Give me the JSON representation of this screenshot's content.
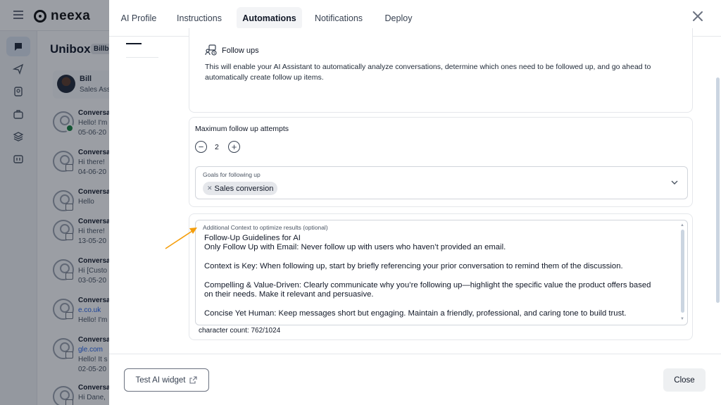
{
  "app": {
    "logo_text": "neexa",
    "unibox_title": "Unibox",
    "unibox_badge": "Billb",
    "pinned_contact": {
      "name": "Bill",
      "subtitle": "Sales Ass"
    },
    "conversations": [
      {
        "title": "Conversa",
        "line2": "Hello! I'm",
        "line3": "05-06-20",
        "channel": "whatsapp",
        "link": false
      },
      {
        "title": "Conversa",
        "line2": "Hi there! ",
        "line3": "04-06-20",
        "channel": "chat",
        "link": false
      },
      {
        "title": "Conversa",
        "line2": "Hello",
        "line3": "",
        "channel": "chat",
        "link": false
      },
      {
        "title": "Conversa",
        "line2": "Hi there! ",
        "line3": "13-05-20",
        "channel": "chat",
        "link": false
      },
      {
        "title": "Conversa",
        "line2": "Hi [Custo",
        "line3": "03-05-20",
        "channel": "chat",
        "link": false
      },
      {
        "title": "Conversa",
        "line2": "e.co.uk",
        "line3": "Hello! I'm",
        "channel": "email",
        "link": true
      },
      {
        "title": "Conversa",
        "line2": "gle.com",
        "line3": "Hello! It s",
        "line4": "02-05-20",
        "channel": "email",
        "link": true
      },
      {
        "title": "Conversa",
        "line2": "Hi Dane, ",
        "line3": "",
        "channel": "email",
        "link": false
      }
    ]
  },
  "modal": {
    "tabs": [
      {
        "label": "AI Profile",
        "active": false
      },
      {
        "label": "Instructions",
        "active": false
      },
      {
        "label": "Automations",
        "active": true
      },
      {
        "label": "Notifications",
        "active": false
      },
      {
        "label": "Deploy",
        "active": false
      }
    ],
    "close_icon": "close-icon",
    "follow_ups": {
      "icon": "follow-ups-icon",
      "title": "Follow ups",
      "description": "This will enable your AI Assistant to automatically analyze conversations, determine which ones need to be followed up, and go ahead to automatically create follow up items."
    },
    "max_attempts": {
      "label": "Maximum follow up attempts",
      "value": "2",
      "decrement_icon": "minus-circle-icon",
      "increment_icon": "plus-circle-icon"
    },
    "goals": {
      "label": "Goals for following up",
      "selected": [
        "Sales conversion"
      ]
    },
    "additional_context": {
      "label": "Additional Context to optimize results (optional)",
      "lines": [
        "Follow-Up Guidelines for AI",
        "Only Follow Up with Email: Never follow up with users who haven’t provided an email.",
        "",
        "Context is Key: When following up, start by briefly referencing your prior conversation to remind them of the discussion.",
        "",
        "Compelling & Value-Driven: Clearly communicate why you’re following up—highlight the specific value the product offers based",
        "on their needs. Make it relevant and persuasive.",
        "",
        "Concise Yet Human: Keep messages short but engaging. Maintain a friendly, professional, and caring tone to build trust."
      ],
      "char_count": "character count: 762/1024"
    },
    "footer": {
      "test_button": "Test AI widget",
      "close_button": "Close"
    }
  },
  "colors": {
    "annotation_arrow": "#f59e0b",
    "overlay": "#111827"
  }
}
